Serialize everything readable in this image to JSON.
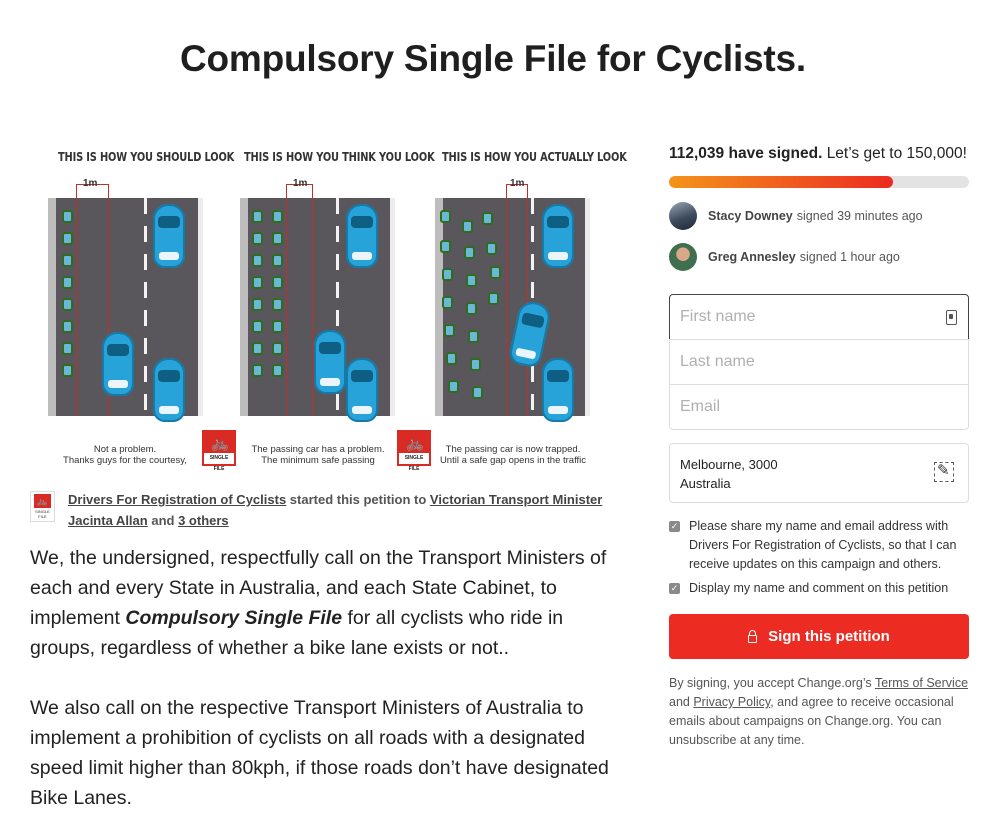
{
  "page": {
    "title": "Compulsory Single File for Cyclists."
  },
  "illustration": {
    "panels": [
      {
        "heading": "THIS IS HOW YOU SHOULD LOOK",
        "caption_line1": "Not a problem.",
        "caption_line2": "Thanks guys for the courtesy,"
      },
      {
        "heading": "THIS IS HOW YOU THINK YOU LOOK",
        "caption_line1": "The passing car has a problem.",
        "caption_line2": "The minimum safe passing"
      },
      {
        "heading": "THIS IS HOW YOU ACTUALLY LOOK",
        "caption_line1": "The passing car is now trapped.",
        "caption_line2": "Until a safe gap opens in the traffic"
      }
    ],
    "meter_label": "1m",
    "badge_label": "SINGLE FILE",
    "badge_icon": "bicycle-icon"
  },
  "starter": {
    "icon_label": "SINGLE FILE",
    "organizer": "Drivers For Registration of Cyclists",
    "action": "started this petition to",
    "target": "Victorian Transport Minister Jacinta Allan",
    "and": "and",
    "others": "3 others"
  },
  "body": {
    "p1_before": "We, the undersigned, respectfully call on the Transport Ministers of each and every State in Australia, and each State Cabinet, to implement",
    "p1_emph": "Compulsory Single File",
    "p1_after": "for all cyclists who ride in groups,  regardless of whether a bike lane exists or not..",
    "p2": "We also call on the respective Transport Ministers of Australia to implement a prohibition of cyclists on all roads with a designated speed limit higher than 80kph,  if those roads don’t have designated Bike Lanes."
  },
  "progress": {
    "count_text": "112,039 have signed.",
    "goal_text": "Let’s get to 150,000!",
    "fraction": 0.747,
    "colors": {
      "start": "#f4931a",
      "end": "#ec2b21",
      "track": "#e3e3e3"
    }
  },
  "recent_signers": [
    {
      "name": "Stacy Downey",
      "when": "signed 39 minutes ago"
    },
    {
      "name": "Greg Annesley",
      "when": "signed 1 hour ago"
    }
  ],
  "form": {
    "first_name_placeholder": "First name",
    "last_name_placeholder": "Last name",
    "email_placeholder": "Email",
    "location_line1": "Melbourne, 3000",
    "location_line2": "Australia",
    "share_consent": "Please share my name and email address with Drivers For Registration of Cyclists, so that I can receive updates on this campaign and others.",
    "display_consent": "Display my name and comment on this petition",
    "sign_button": "Sign this petition",
    "button_color": "#ec2c22"
  },
  "legal": {
    "prefix": "By signing, you accept Change.org’s",
    "terms": "Terms of Service",
    "and": "and",
    "privacy": "Privacy Policy",
    "suffix": ", and agree to receive occasional emails about campaigns on Change.org. You can unsubscribe at any time."
  }
}
